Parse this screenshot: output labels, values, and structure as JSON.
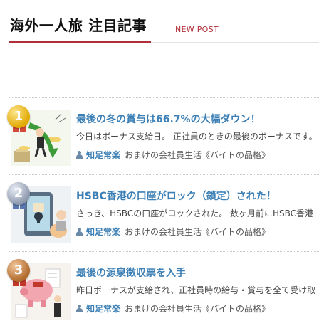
{
  "header": {
    "title": "海外一人旅 注目記事",
    "subtitle": "NEW POST"
  },
  "posts": [
    {
      "rank": "1",
      "title": "最後の冬の賞与は66.7%の大幅ダウン！",
      "excerpt": "今日はボーナス支給日。 正社員のときの最後のボーナスです。",
      "author": "知足常楽",
      "category": "おまけの会社員生活《バイトの品格》"
    },
    {
      "rank": "2",
      "title": "HSBC香港の口座がロック（鎖定）された！",
      "excerpt": "さっき、HSBCの口座がロックされた。 数ヶ月前にHSBC香港",
      "author": "知足常楽",
      "category": "おまけの会社員生活《バイトの品格》"
    },
    {
      "rank": "3",
      "title": "最後の源泉徴収票を入手",
      "excerpt": "昨日ボーナスが支給され、正社員時の給与・賞与を全て受け取",
      "author": "知足常楽",
      "category": "おまけの会社員生活《バイトの品格》"
    }
  ],
  "colors": {
    "accent": "#b0303a",
    "link": "#3b7fb5"
  },
  "icons": {
    "author": "person-icon"
  }
}
